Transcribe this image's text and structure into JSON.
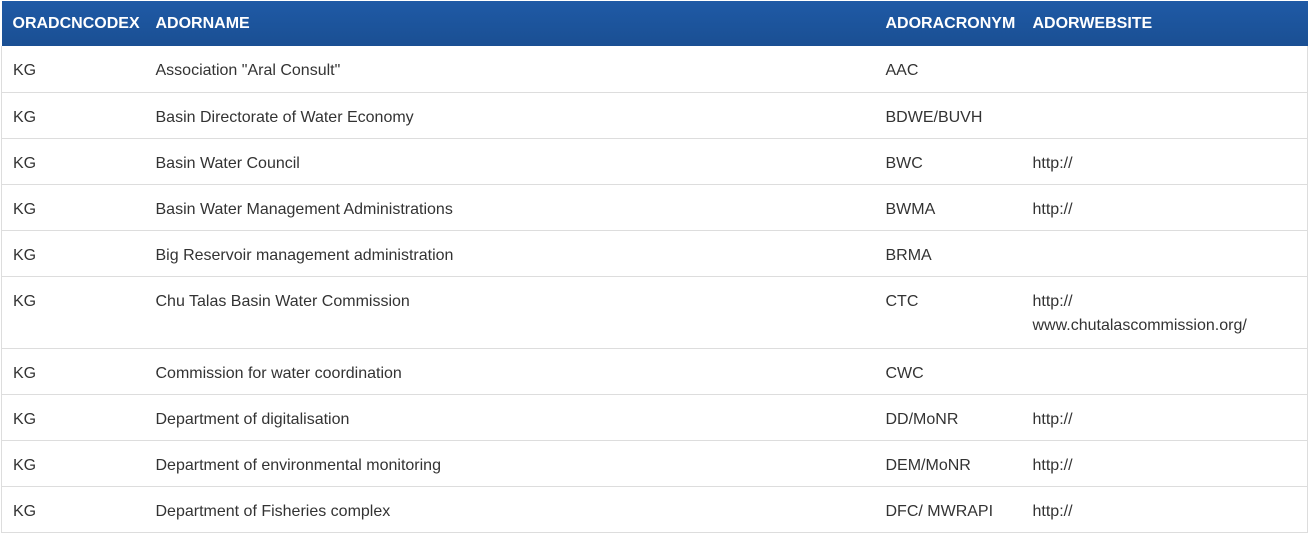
{
  "table": {
    "headers": [
      "ORADCNCODEX",
      "ADORNAME",
      "ADORACRONYM",
      "ADORWEBSITE"
    ],
    "rows": [
      {
        "code": "KG",
        "name": "Association \"Aral Consult\"",
        "acronym": "AAC",
        "website": ""
      },
      {
        "code": "KG",
        "name": "Basin Directorate of Water Economy",
        "acronym": "BDWE/BUVH",
        "website": ""
      },
      {
        "code": "KG",
        "name": "Basin Water Council",
        "acronym": "BWC",
        "website": "http://"
      },
      {
        "code": "KG",
        "name": "Basin Water Management Administrations",
        "acronym": "BWMA",
        "website": "http://"
      },
      {
        "code": "KG",
        "name": "Big Reservoir management administration",
        "acronym": "BRMA",
        "website": ""
      },
      {
        "code": "KG",
        "name": "Chu Talas Basin Water Commission",
        "acronym": "CTC",
        "website": "http://\nwww.chutalascommission.org/"
      },
      {
        "code": "KG",
        "name": "Commission for water coordination",
        "acronym": "CWC",
        "website": ""
      },
      {
        "code": "KG",
        "name": "Department of digitalisation",
        "acronym": "DD/MoNR",
        "website": "http://"
      },
      {
        "code": "KG",
        "name": "Department of environmental monitoring",
        "acronym": "DEM/MoNR",
        "website": "http://"
      },
      {
        "code": "KG",
        "name": "Department of Fisheries complex",
        "acronym": "DFC/ MWRAPI",
        "website": "http://"
      }
    ]
  },
  "colors": {
    "header_bg": "#1c55a0",
    "header_text": "#ffffff",
    "row_border": "#dddddd",
    "text": "#333333"
  }
}
